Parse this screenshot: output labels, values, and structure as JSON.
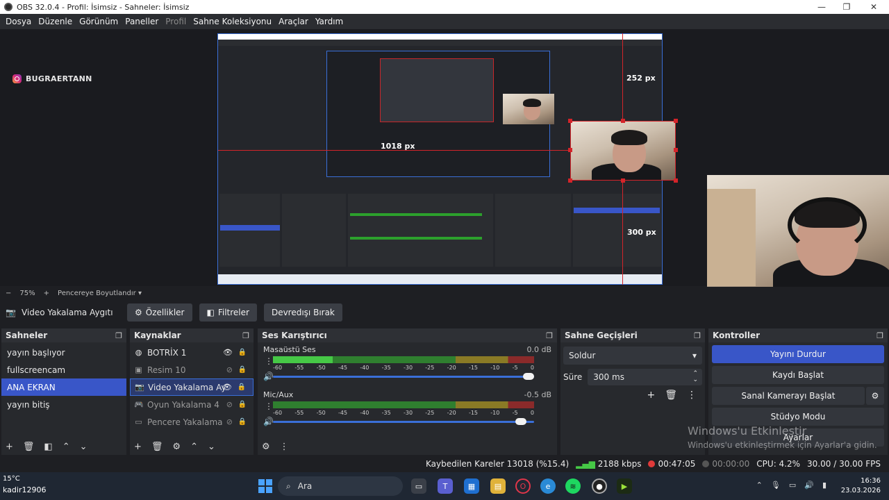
{
  "window": {
    "title": "OBS 32.0.4 - Profil: İsimsiz - Sahneler: İsimsiz",
    "controls": [
      "—",
      "❐",
      "✕"
    ]
  },
  "menu": {
    "items": [
      "Dosya",
      "Düzenle",
      "Görünüm",
      "Paneller",
      "Profil",
      "Sahne Koleksiyonu",
      "Araçlar",
      "Yardım"
    ]
  },
  "preview": {
    "instagram_handle": "BUGRAERTANN",
    "px_labels": [
      "252 px",
      "1018 px",
      "300 px"
    ]
  },
  "zoom": {
    "minus": "−",
    "value": "75%",
    "plus": "+",
    "mode": "Pencereye Boyutlandır"
  },
  "context": {
    "source_name": "Video Yakalama Aygıtı",
    "properties_label": "Özellikler",
    "filters_label": "Filtreler",
    "deactivate_label": "Devredışı Bırak"
  },
  "scenes": {
    "title": "Sahneler",
    "items": [
      "yayın başlıyor",
      "fullscreencam",
      "ANA EKRAN",
      "yayın bitiş"
    ],
    "selected": "ANA EKRAN"
  },
  "sources": {
    "title": "Kaynaklar",
    "items": [
      {
        "label": "BOTRİX 1",
        "icon": "browser-icon",
        "visible": true
      },
      {
        "label": "Resim 10",
        "icon": "image-icon",
        "visible": false
      },
      {
        "label": "Video Yakalama Ay",
        "icon": "camera-icon",
        "visible": true
      },
      {
        "label": "Oyun Yakalama 4",
        "icon": "gamepad-icon",
        "visible": false
      },
      {
        "label": "Pencere Yakalama",
        "icon": "window-icon",
        "visible": false
      }
    ],
    "selected": "Video Yakalama Ay"
  },
  "mixer": {
    "title": "Ses Karıştırıcı",
    "ticks": [
      "-60",
      "-55",
      "-50",
      "-45",
      "-40",
      "-35",
      "-30",
      "-25",
      "-20",
      "-15",
      "-10",
      "-5",
      "0"
    ],
    "channels": [
      {
        "name": "Masaüstü Ses",
        "db": "0.0 dB",
        "level": 0.23,
        "volume": 1.0
      },
      {
        "name": "Mic/Aux",
        "db": "-0.5 dB",
        "level": 0.0,
        "volume": 0.97
      }
    ]
  },
  "transitions": {
    "title": "Sahne Geçişleri",
    "selected": "Soldur",
    "duration_label": "Süre",
    "duration_value": "300 ms"
  },
  "controls": {
    "title": "Kontroller",
    "stop_stream": "Yayını Durdur",
    "start_record": "Kaydı Başlat",
    "virtual_cam": "Sanal Kamerayı Başlat",
    "studio_mode": "Stüdyo Modu",
    "settings": "Ayarlar"
  },
  "activation": {
    "line1": "Windows'u Etkinleştir",
    "line2": "Windows'u etkinleştirmek için Ayarlar'a gidin."
  },
  "status": {
    "dropped": "Kaybedilen Kareler 13018 (%15.4)",
    "bitrate": "2188 kbps",
    "stream_time": "00:47:05",
    "record_time": "00:00:00",
    "cpu": "CPU: 4.2%",
    "fps": "30.00 / 30.00 FPS",
    "live_color": "#e03a3a"
  },
  "taskbar": {
    "temperature": "15°C",
    "user": "kadir12906",
    "search": "Ara",
    "time": "16:36",
    "date": "23.03.2026"
  }
}
